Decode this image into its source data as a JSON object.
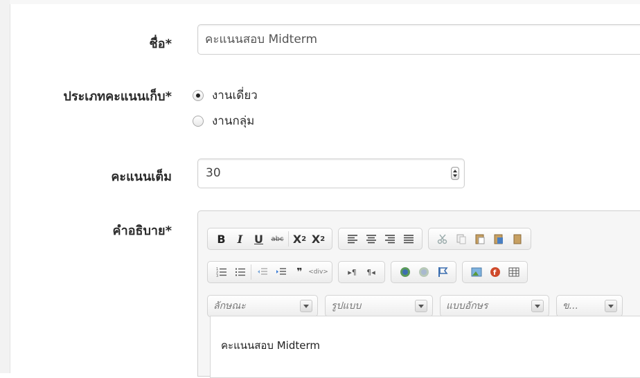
{
  "form": {
    "name": {
      "label": "ชื่อ*",
      "value": "คะแนนสอบ Midterm"
    },
    "score_type": {
      "label": "ประเภทคะแนนเก็บ*",
      "options": [
        {
          "label": "งานเดี่ยว",
          "selected": true
        },
        {
          "label": "งานกลุ่ม",
          "selected": false
        }
      ]
    },
    "full_score": {
      "label": "คะแนนเต็ม",
      "value": "30"
    },
    "description": {
      "label": "คำอธิบาย*",
      "content": "คะแนนสอบ Midterm",
      "toolbar": {
        "row1": [
          "B",
          "I",
          "U",
          "abc",
          "X2",
          "X2"
        ],
        "combos": [
          "ลักษณะ",
          "รูปแบบ",
          "แบบอักษร",
          "ข..."
        ]
      }
    }
  },
  "colors": {
    "accent": "#cf4a2b",
    "border": "#cfcfcf",
    "toolbar_bg": "#f6f6f6"
  }
}
